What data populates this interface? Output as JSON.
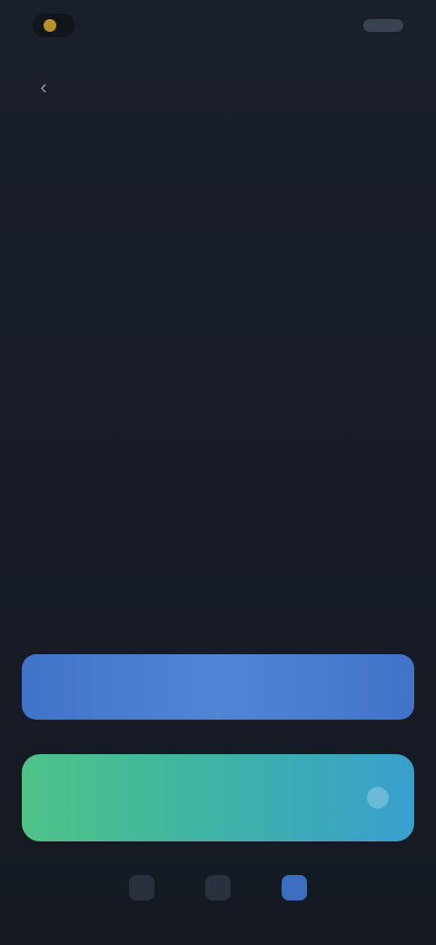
{
  "status_bar": {
    "app_name": "",
    "time": ""
  },
  "header": {
    "back_icon": "chevron-left-icon",
    "title": ""
  },
  "content": {
    "intro": "",
    "sections": [
      {
        "label": "",
        "value": ""
      },
      {
        "label": "",
        "value": ""
      },
      {
        "label": "",
        "value": ""
      }
    ]
  },
  "actions": {
    "primary_label": "",
    "accent_label": "",
    "accent_icon": "arrow-right-icon"
  },
  "tabs": [
    {
      "label": "",
      "icon": "home-icon",
      "active": false
    },
    {
      "label": "",
      "icon": "grid-icon",
      "active": false
    },
    {
      "label": "",
      "icon": "profile-icon",
      "active": true
    }
  ],
  "colors": {
    "background": "#161b24",
    "primary_button": "#4a80d1",
    "accent_start": "#4fc387",
    "accent_end": "#3a9fcf"
  }
}
